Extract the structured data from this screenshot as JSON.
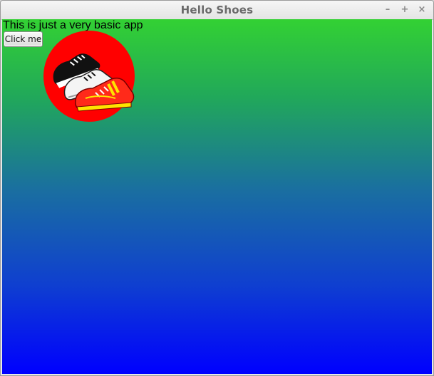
{
  "window": {
    "title": "Hello Shoes",
    "controls": {
      "minimize": "–",
      "maximize": "+",
      "close": "×"
    }
  },
  "content": {
    "label": "This is just a very basic app",
    "button_label": "Click me",
    "logo_icon": "shoes-logo-icon",
    "colors": {
      "gradient_top": "#33d133",
      "gradient_bottom": "#0000ff",
      "logo_circle": "#ff0000"
    }
  }
}
